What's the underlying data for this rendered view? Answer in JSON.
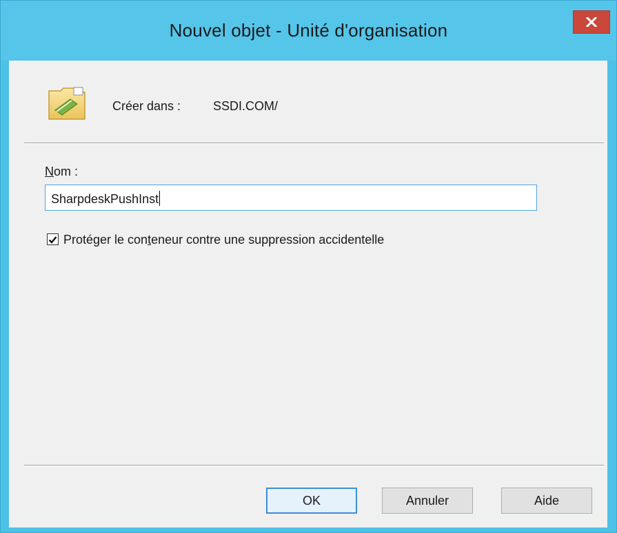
{
  "window": {
    "title": "Nouvel objet - Unité d'organisation",
    "close_icon": "close-icon"
  },
  "header": {
    "icon": "organizational-unit-icon",
    "create_in_label": "Créer dans :",
    "create_in_path": "SSDI.COM/"
  },
  "form": {
    "name_label_mnemonic": "N",
    "name_label_rest": "om :",
    "name_value": "SharpdeskPushInst",
    "protect_checked": true,
    "protect_label_part1": "Protéger le con",
    "protect_label_mnemonic": "t",
    "protect_label_part2": "eneur contre une suppression accidentelle"
  },
  "buttons": {
    "ok_label": "OK",
    "cancel_label": "Annuler",
    "help_label": "Aide"
  },
  "colors": {
    "titlebar": "#55c5ea",
    "close_button": "#c9483b",
    "focus_border": "#3c8dd8"
  }
}
